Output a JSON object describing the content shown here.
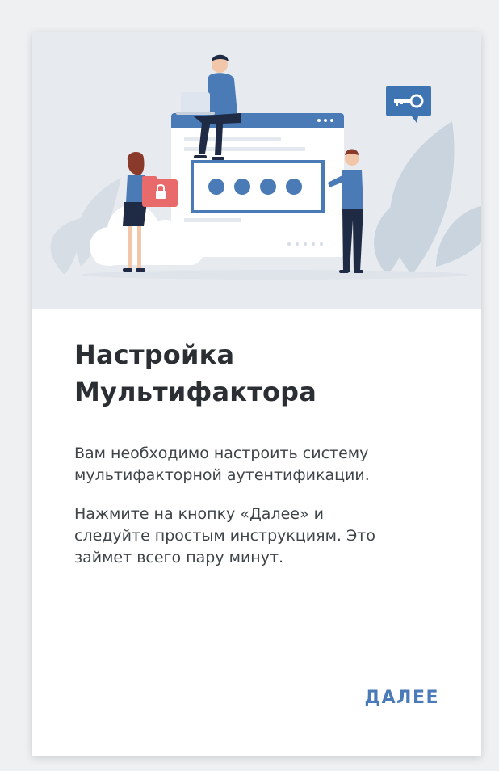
{
  "dialog": {
    "title_line1": "Настройка",
    "title_line2": "Мультифактора",
    "paragraph1_line1": "Вам необходимо настроить систему",
    "paragraph1_line2": "мультифакторной аутентификации.",
    "paragraph2_line1": "Нажмите на кнопку «Далее» и",
    "paragraph2_line2": "следуйте простым инструкциям. Это",
    "paragraph2_line3": "займет всего пару минут.",
    "next_label": "ДАЛЕЕ"
  },
  "colors": {
    "accent": "#4a7bb7",
    "hero_background": "#e7ebef",
    "lock_badge": "#e86a6a",
    "key_badge": "#3f74b3"
  },
  "illustration": {
    "icons": [
      "laptop-icon",
      "lock-icon",
      "key-icon",
      "password-dots-icon"
    ]
  }
}
